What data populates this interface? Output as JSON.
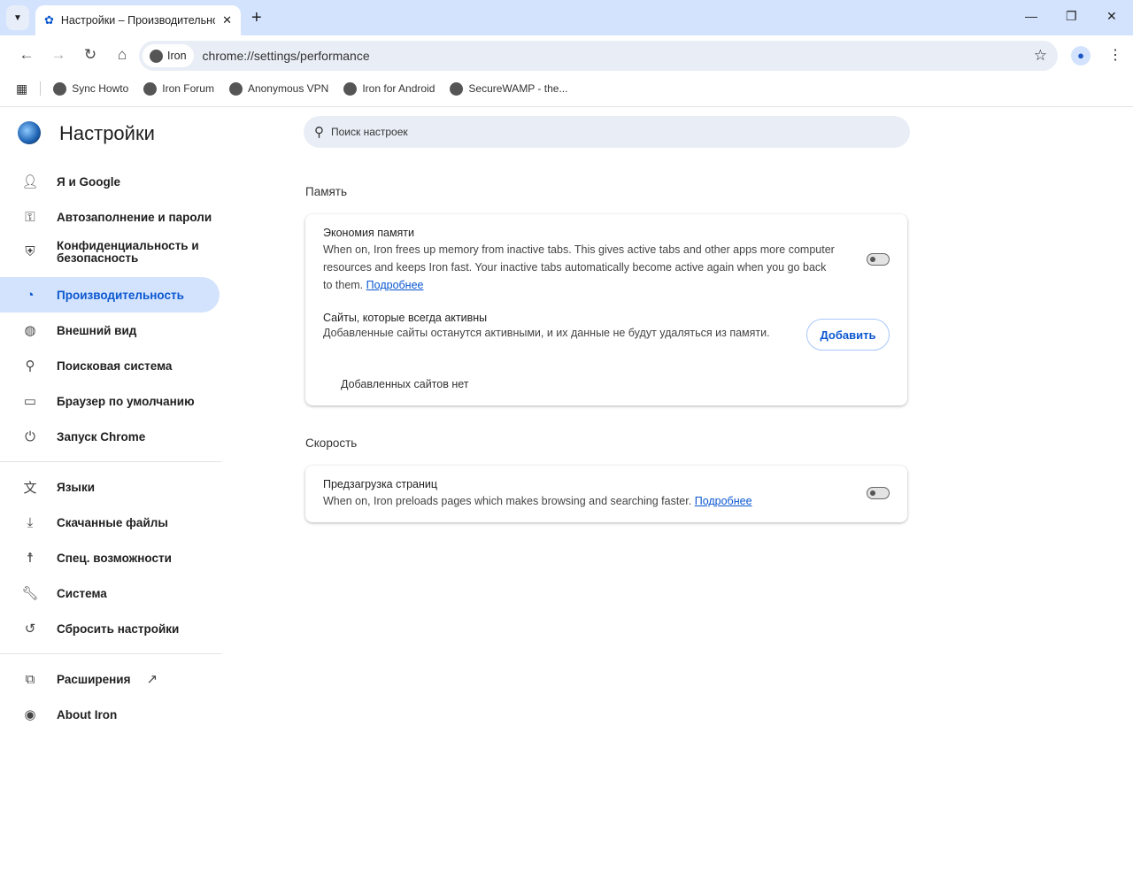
{
  "tab": {
    "title": "Настройки – Производительность"
  },
  "omnibox": {
    "chip": "Iron",
    "url": "chrome://settings/performance"
  },
  "bookmarks": [
    "Sync Howto",
    "Iron Forum",
    "Anonymous VPN",
    "Iron for Android",
    "SecureWAMP - the..."
  ],
  "settings": {
    "title": "Настройки",
    "search_placeholder": "Поиск настроек"
  },
  "nav": [
    {
      "label": "Я и Google",
      "icon": "person-icon"
    },
    {
      "label": "Автозаполнение и пароли",
      "icon": "key-icon"
    },
    {
      "label": "Конфиденциальность и безопасность",
      "icon": "shield-icon"
    },
    {
      "label": "Производительность",
      "icon": "speedometer-icon"
    },
    {
      "label": "Внешний вид",
      "icon": "palette-icon"
    },
    {
      "label": "Поисковая система",
      "icon": "search-icon"
    },
    {
      "label": "Браузер по умолчанию",
      "icon": "browser-icon"
    },
    {
      "label": "Запуск Chrome",
      "icon": "power-icon"
    },
    {
      "label": "Языки",
      "icon": "translate-icon"
    },
    {
      "label": "Скачанные файлы",
      "icon": "download-icon"
    },
    {
      "label": "Спец. возможности",
      "icon": "accessibility-icon"
    },
    {
      "label": "Система",
      "icon": "wrench-icon"
    },
    {
      "label": "Сбросить настройки",
      "icon": "reset-icon"
    },
    {
      "label": "Расширения",
      "icon": "puzzle-icon"
    },
    {
      "label": "About Iron",
      "icon": "iron-icon"
    }
  ],
  "memory": {
    "section": "Память",
    "title": "Экономия памяти",
    "desc": "When on, Iron frees up memory from inactive tabs. This gives active tabs and other apps more computer resources and keeps Iron fast. Your inactive tabs automatically become active again when you go back to them.",
    "link": "Подробнее",
    "enabled": false,
    "sites_title": "Сайты, которые всегда активны",
    "sites_desc": "Добавленные сайты останутся активными, и их данные не будут удаляться из памяти.",
    "add": "Добавить",
    "empty": "Добавленных сайтов нет"
  },
  "speed": {
    "section": "Скорость",
    "title": "Предзагрузка страниц",
    "desc": "When on, Iron preloads pages which makes browsing and searching faster.",
    "link": "Подробнее",
    "enabled": false
  }
}
